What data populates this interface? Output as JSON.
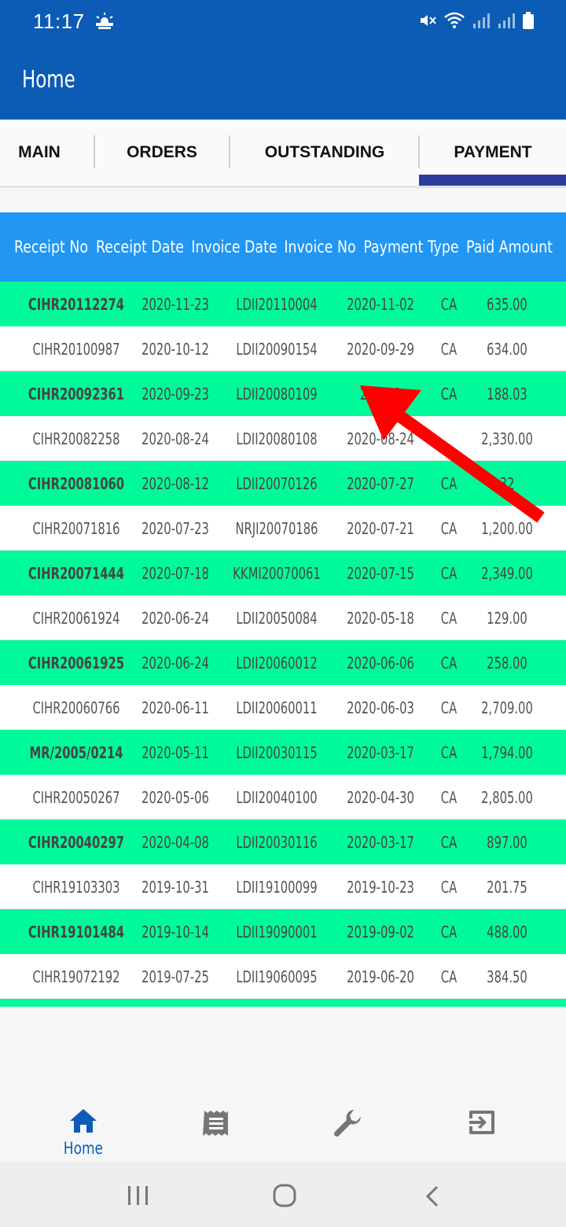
{
  "status_bar": {
    "time": "11:17",
    "weather_icon": "partly-cloudy-icon",
    "icons": [
      "mute-icon",
      "wifi-icon",
      "signal-icon",
      "signal-icon",
      "battery-icon"
    ]
  },
  "app_bar": {
    "title": "Home",
    "color": "#0c5cb5"
  },
  "tabs": [
    {
      "label": "MAIN"
    },
    {
      "label": "ORDERS"
    },
    {
      "label": "OUTSTANDING"
    },
    {
      "label": "PAYMENT",
      "selected": true
    }
  ],
  "table": {
    "headers": [
      "Receipt No",
      "Receipt Date",
      "Invoice Date",
      "Invoice No",
      "Payment Type",
      "Paid Amount"
    ],
    "rows": [
      [
        "CIHR20112274",
        "2020-11-23",
        "LDII20110004",
        "2020-11-02",
        "CA",
        "635.00"
      ],
      [
        "CIHR20100987",
        "2020-10-12",
        "LDII20090154",
        "2020-09-29",
        "CA",
        "634.00"
      ],
      [
        "CIHR20092361",
        "2020-09-23",
        "LDII20080109",
        "2020-0",
        "CA",
        "188.03"
      ],
      [
        "CIHR20082258",
        "2020-08-24",
        "LDII20080108",
        "2020-08-24",
        "",
        "2,330.00"
      ],
      [
        "CIHR20081060",
        "2020-08-12",
        "LDII20070126",
        "2020-07-27",
        "CA",
        "32"
      ],
      [
        "CIHR20071816",
        "2020-07-23",
        "NRJI20070186",
        "2020-07-21",
        "CA",
        "1,200.00"
      ],
      [
        "CIHR20071444",
        "2020-07-18",
        "KKMI20070061",
        "2020-07-15",
        "CA",
        "2,349.00"
      ],
      [
        "CIHR20061924",
        "2020-06-24",
        "LDII20050084",
        "2020-05-18",
        "CA",
        "129.00"
      ],
      [
        "CIHR20061925",
        "2020-06-24",
        "LDII20060012",
        "2020-06-06",
        "CA",
        "258.00"
      ],
      [
        "CIHR20060766",
        "2020-06-11",
        "LDII20060011",
        "2020-06-03",
        "CA",
        "2,709.00"
      ],
      [
        "MR/2005/0214",
        "2020-05-11",
        "LDII20030115",
        "2020-03-17",
        "CA",
        "1,794.00"
      ],
      [
        "CIHR20050267",
        "2020-05-06",
        "LDII20040100",
        "2020-04-30",
        "CA",
        "2,805.00"
      ],
      [
        "CIHR20040297",
        "2020-04-08",
        "LDII20030116",
        "2020-03-17",
        "CA",
        "897.00"
      ],
      [
        "CIHR19103303",
        "2019-10-31",
        "LDII19100099",
        "2019-10-23",
        "CA",
        "201.75"
      ],
      [
        "CIHR19101484",
        "2019-10-14",
        "LDII19090001",
        "2019-09-02",
        "CA",
        "488.00"
      ],
      [
        "CIHR19072192",
        "2019-07-25",
        "LDII19060095",
        "2019-06-20",
        "CA",
        "384.50"
      ]
    ],
    "header_color": "#2196f3",
    "stripe_color": "#00fa9a"
  },
  "bottom_nav": [
    {
      "icon": "home-icon",
      "label": "Home",
      "active": true
    },
    {
      "icon": "receipt-icon"
    },
    {
      "icon": "wrench-icon"
    },
    {
      "icon": "logout-icon"
    }
  ],
  "system_nav": [
    "recents-icon",
    "home-circle-icon",
    "back-icon"
  ],
  "annotation": {
    "arrow_color": "#ff0000"
  }
}
